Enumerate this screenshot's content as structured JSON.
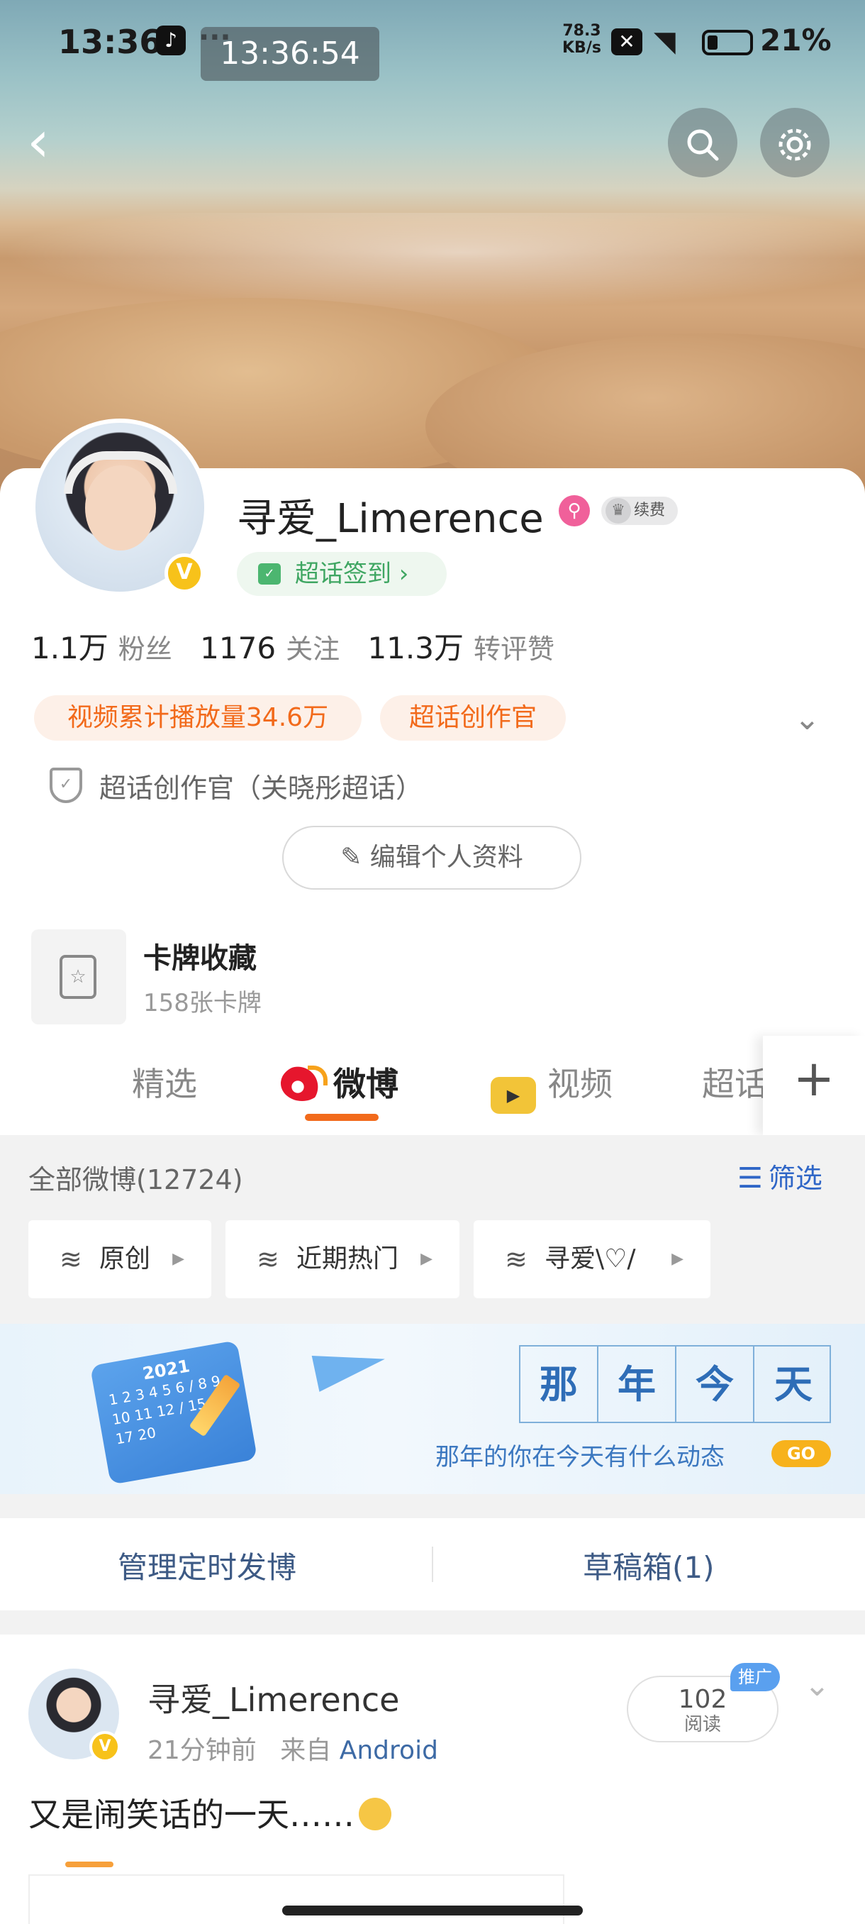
{
  "status_bar": {
    "time": "13:36",
    "overlay_clock": "13:36:54",
    "more_dots": "···",
    "net_speed_value": "78.3",
    "net_speed_unit": "KB/s",
    "battery_pct": "21%"
  },
  "profile": {
    "name": "寻爱_Limerence",
    "vip_label": "续费",
    "signin_label": "超话签到 ›",
    "stats": [
      {
        "value": "1.1万",
        "label": "粉丝"
      },
      {
        "value": "1176",
        "label": "关注"
      },
      {
        "value": "11.3万",
        "label": "转评赞"
      }
    ],
    "tags": [
      "视频累计播放量34.6万",
      "超话创作官"
    ],
    "creator_text": "超话创作官（关晓彤超话）",
    "edit_button": "编辑个人资料",
    "card_title": "卡牌收藏",
    "card_sub": "158张卡牌"
  },
  "tabs": {
    "items": [
      "精选",
      "微博",
      "视频",
      "超话"
    ],
    "active": "微博"
  },
  "filter": {
    "all_label": "全部微博(12724)",
    "sift_label": "筛选",
    "chips": [
      "原创",
      "近期热门",
      "寻爱\\♡/"
    ]
  },
  "promo": {
    "chars": [
      "那",
      "年",
      "今",
      "天"
    ],
    "subtitle": "那年的你在今天有什么动态",
    "go_label": "GO",
    "calendar_year": "2021",
    "calendar_nums": "1 2 3 4 5 6 / 8 9 10 11 12 / 15 16 17 20"
  },
  "manage": {
    "scheduled": "管理定时发博",
    "drafts": "草稿箱(1)"
  },
  "post": {
    "author": "寻爱_Limerence",
    "time": "21分钟前",
    "from_label": "来自",
    "source": "Android",
    "reads_count": "102",
    "reads_label": "阅读",
    "ad_label": "推广",
    "text": "又是闹笑话的一天……"
  },
  "icons": {
    "back": "back-chevron-icon",
    "search": "search-icon",
    "settings": "gear-icon"
  },
  "colors": {
    "accent": "#f26a1b",
    "link": "#2f66c7",
    "verified": "#f7c21a"
  }
}
